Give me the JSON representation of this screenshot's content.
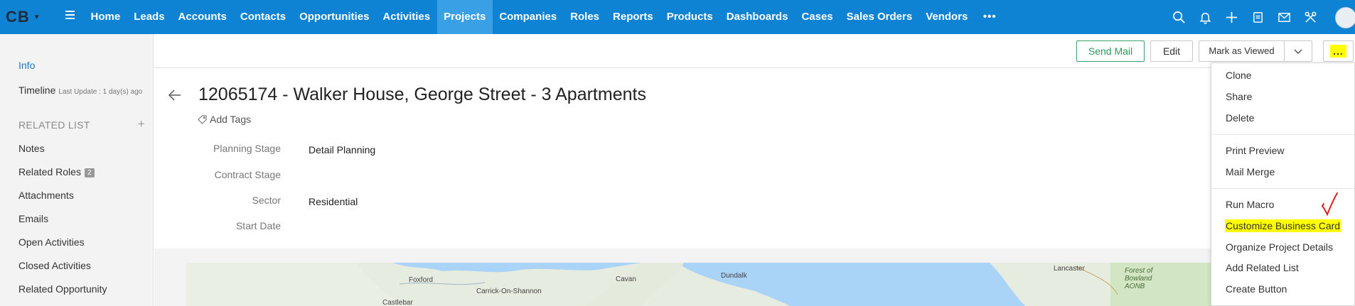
{
  "brand": {
    "logo": "CB"
  },
  "nav": {
    "items": [
      "Home",
      "Leads",
      "Accounts",
      "Contacts",
      "Opportunities",
      "Activities",
      "Projects",
      "Companies",
      "Roles",
      "Reports",
      "Products",
      "Dashboards",
      "Cases",
      "Sales Orders",
      "Vendors"
    ],
    "active": "Projects",
    "more": "•••"
  },
  "top_icons": [
    "search-icon",
    "bell-icon",
    "plus-icon",
    "calendar-icon",
    "mail-icon",
    "settings-tools-icon"
  ],
  "sidebar": {
    "info": "Info",
    "timeline": "Timeline",
    "timeline_sub": "Last Update : 1 day(s) ago",
    "related_list": "RELATED LIST",
    "items": [
      {
        "label": "Notes"
      },
      {
        "label": "Related Roles",
        "badge": "2"
      },
      {
        "label": "Attachments"
      },
      {
        "label": "Emails"
      },
      {
        "label": "Open Activities"
      },
      {
        "label": "Closed Activities"
      },
      {
        "label": "Related Opportunity"
      }
    ]
  },
  "actions": {
    "send_mail": "Send Mail",
    "edit": "Edit",
    "mark_as_viewed": "Mark as Viewed",
    "more": "..."
  },
  "record": {
    "title": "12065174 - Walker House, George Street - 3 Apartments",
    "add_tags": "Add Tags",
    "fields": [
      {
        "label": "Planning Stage",
        "value": "Detail Planning"
      },
      {
        "label": "Contract Stage",
        "value": ""
      },
      {
        "label": "Sector",
        "value": "Residential"
      },
      {
        "label": "Start Date",
        "value": ""
      }
    ]
  },
  "map": {
    "labels": [
      "Foxford",
      "Carrick-On-Shannon",
      "Cavan",
      "Dundalk",
      "Castlebar",
      "Lancaster",
      "Forest of Bowland AONB"
    ]
  },
  "menu": {
    "groups": [
      [
        "Clone",
        "Share",
        "Delete"
      ],
      [
        "Print Preview",
        "Mail Merge"
      ],
      [
        "Run Macro",
        "Customize Business Card",
        "Organize Project Details",
        "Add Related List",
        "Create Button"
      ]
    ],
    "highlighted": "Customize Business Card"
  },
  "colors": {
    "topbar": "#0f83d3",
    "active_tab": "#3aa0e6",
    "highlight": "#ffff00",
    "send_mail": "#2a9a5e",
    "annotation": "#e02020"
  }
}
